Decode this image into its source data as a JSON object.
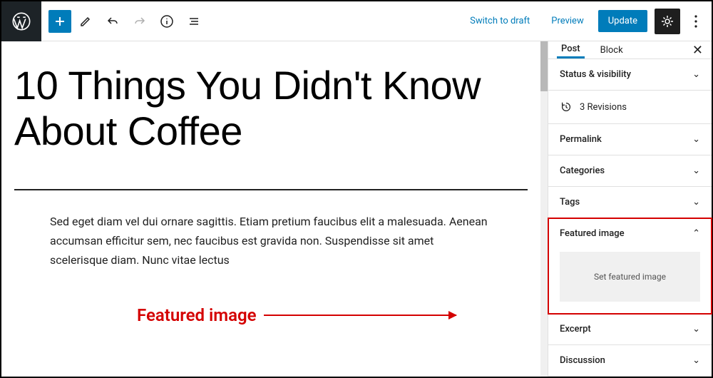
{
  "topbar": {
    "switch_draft": "Switch to draft",
    "preview": "Preview",
    "update": "Update"
  },
  "editor": {
    "title": "10 Things You Didn't Know About Coffee",
    "body": "Sed eget diam vel dui ornare sagittis. Etiam pretium faucibus elit a malesuada. Aenean accumsan efficitur sem, nec faucibus est gravida non. Suspendisse sit amet scelerisque diam. Nunc vitae lectus"
  },
  "callout": {
    "label": "Featured image"
  },
  "sidebar": {
    "tabs": {
      "post": "Post",
      "block": "Block"
    },
    "panels": {
      "status": "Status & visibility",
      "revisions": "3 Revisions",
      "permalink": "Permalink",
      "categories": "Categories",
      "tags": "Tags",
      "featured": "Featured image",
      "set_featured": "Set featured image",
      "excerpt": "Excerpt",
      "discussion": "Discussion"
    }
  }
}
